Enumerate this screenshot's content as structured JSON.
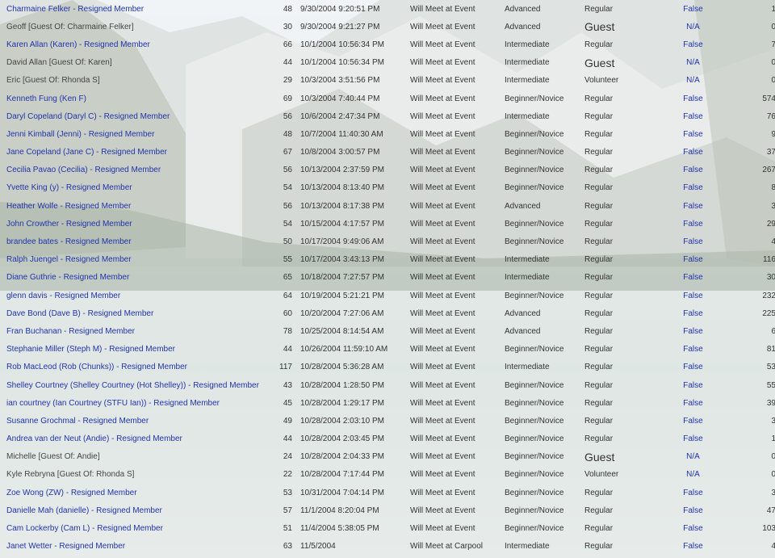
{
  "rows": [
    {
      "name": "Charmaine Felker - Resigned Member",
      "link": true,
      "age": "48",
      "date": "9/30/2004 9:20:51 PM",
      "meet": "Will Meet at Event",
      "level": "Advanced",
      "type": "Regular",
      "flag": "False",
      "num": "1"
    },
    {
      "name": "Geoff [Guest Of: Charmaine Felker]",
      "link": false,
      "age": "30",
      "date": "9/30/2004 9:21:27 PM",
      "meet": "Will Meet at Event",
      "level": "Advanced",
      "type": "Guest",
      "flag": "N/A",
      "num": "0"
    },
    {
      "name": "Karen Allan (Karen) - Resigned Member",
      "link": true,
      "age": "66",
      "date": "10/1/2004 10:56:34 PM",
      "meet": "Will Meet at Event",
      "level": "Intermediate",
      "type": "Regular",
      "flag": "False",
      "num": "7"
    },
    {
      "name": "David Allan [Guest Of: Karen]",
      "link": false,
      "age": "44",
      "date": "10/1/2004 10:56:34 PM",
      "meet": "Will Meet at Event",
      "level": "Intermediate",
      "type": "Guest",
      "flag": "N/A",
      "num": "0"
    },
    {
      "name": "Eric [Guest Of: Rhonda S]",
      "link": false,
      "age": "29",
      "date": "10/3/2004 3:51:56 PM",
      "meet": "Will Meet at Event",
      "level": "Intermediate",
      "type": "Volunteer",
      "flag": "N/A",
      "num": "0"
    },
    {
      "name": "Kenneth Fung (Ken F)",
      "link": true,
      "age": "69",
      "date": "10/3/2004 7:40:44 PM",
      "meet": "Will Meet at Event",
      "level": "Beginner/Novice",
      "type": "Regular",
      "flag": "False",
      "num": "574"
    },
    {
      "name": "Daryl Copeland (Daryl C) - Resigned Member",
      "link": true,
      "age": "56",
      "date": "10/6/2004 2:47:34 PM",
      "meet": "Will Meet at Event",
      "level": "Intermediate",
      "type": "Regular",
      "flag": "False",
      "num": "76"
    },
    {
      "name": "Jenni Kimball (Jenni) - Resigned Member",
      "link": true,
      "age": "48",
      "date": "10/7/2004 11:40:30 AM",
      "meet": "Will Meet at Event",
      "level": "Beginner/Novice",
      "type": "Regular",
      "flag": "False",
      "num": "9"
    },
    {
      "name": "Jane Copeland (Jane C) - Resigned Member",
      "link": true,
      "age": "67",
      "date": "10/8/2004 3:00:57 PM",
      "meet": "Will Meet at Event",
      "level": "Beginner/Novice",
      "type": "Regular",
      "flag": "False",
      "num": "37"
    },
    {
      "name": "Cecilia Pavao (Cecilia) - Resigned Member",
      "link": true,
      "age": "56",
      "date": "10/13/2004 2:37:59 PM",
      "meet": "Will Meet at Event",
      "level": "Beginner/Novice",
      "type": "Regular",
      "flag": "False",
      "num": "267"
    },
    {
      "name": "Yvette King (y) - Resigned Member",
      "link": true,
      "age": "54",
      "date": "10/13/2004 8:13:40 PM",
      "meet": "Will Meet at Event",
      "level": "Beginner/Novice",
      "type": "Regular",
      "flag": "False",
      "num": "8"
    },
    {
      "name": "Heather Wolfe - Resigned Member",
      "link": true,
      "age": "56",
      "date": "10/13/2004 8:17:38 PM",
      "meet": "Will Meet at Event",
      "level": "Advanced",
      "type": "Regular",
      "flag": "False",
      "num": "3"
    },
    {
      "name": "John Crowther - Resigned Member",
      "link": true,
      "age": "54",
      "date": "10/15/2004 4:17:57 PM",
      "meet": "Will Meet at Event",
      "level": "Beginner/Novice",
      "type": "Regular",
      "flag": "False",
      "num": "29"
    },
    {
      "name": "brandee bates - Resigned Member",
      "link": true,
      "age": "50",
      "date": "10/17/2004 9:49:06 AM",
      "meet": "Will Meet at Event",
      "level": "Beginner/Novice",
      "type": "Regular",
      "flag": "False",
      "num": "4"
    },
    {
      "name": "Ralph Juengel - Resigned Member",
      "link": true,
      "age": "55",
      "date": "10/17/2004 3:43:13 PM",
      "meet": "Will Meet at Event",
      "level": "Intermediate",
      "type": "Regular",
      "flag": "False",
      "num": "116"
    },
    {
      "name": "Diane Guthrie - Resigned Member",
      "link": true,
      "age": "65",
      "date": "10/18/2004 7:27:57 PM",
      "meet": "Will Meet at Event",
      "level": "Intermediate",
      "type": "Regular",
      "flag": "False",
      "num": "30"
    },
    {
      "name": "glenn davis - Resigned Member",
      "link": true,
      "age": "64",
      "date": "10/19/2004 5:21:21 PM",
      "meet": "Will Meet at Event",
      "level": "Beginner/Novice",
      "type": "Regular",
      "flag": "False",
      "num": "232"
    },
    {
      "name": "Dave Bond (Dave B) - Resigned Member",
      "link": true,
      "age": "60",
      "date": "10/20/2004 7:27:06 AM",
      "meet": "Will Meet at Event",
      "level": "Advanced",
      "type": "Regular",
      "flag": "False",
      "num": "225"
    },
    {
      "name": "Fran Buchanan - Resigned Member",
      "link": true,
      "age": "78",
      "date": "10/25/2004 8:14:54 AM",
      "meet": "Will Meet at Event",
      "level": "Advanced",
      "type": "Regular",
      "flag": "False",
      "num": "6"
    },
    {
      "name": "Stephanie Miller (Steph M) - Resigned Member",
      "link": true,
      "age": "44",
      "date": "10/26/2004 11:59:10 AM",
      "meet": "Will Meet at Event",
      "level": "Beginner/Novice",
      "type": "Regular",
      "flag": "False",
      "num": "81"
    },
    {
      "name": "Rob MacLeod (Rob (Chunks)) - Resigned Member",
      "link": true,
      "age": "117",
      "date": "10/28/2004 5:36:28 AM",
      "meet": "Will Meet at Event",
      "level": "Intermediate",
      "type": "Regular",
      "flag": "False",
      "num": "53"
    },
    {
      "name": "Shelley Courtney (Shelley Courtney (Hot Shelley)) - Resigned Member",
      "link": true,
      "age": "43",
      "date": "10/28/2004 1:28:50 PM",
      "meet": "Will Meet at Event",
      "level": "Beginner/Novice",
      "type": "Regular",
      "flag": "False",
      "num": "55"
    },
    {
      "name": "ian courtney (Ian Courtney (STFU Ian)) - Resigned Member",
      "link": true,
      "age": "45",
      "date": "10/28/2004 1:29:17 PM",
      "meet": "Will Meet at Event",
      "level": "Beginner/Novice",
      "type": "Regular",
      "flag": "False",
      "num": "39"
    },
    {
      "name": "Susanne Grochmal - Resigned Member",
      "link": true,
      "age": "49",
      "date": "10/28/2004 2:03:10 PM",
      "meet": "Will Meet at Event",
      "level": "Beginner/Novice",
      "type": "Regular",
      "flag": "False",
      "num": "3"
    },
    {
      "name": "Andrea van der Neut (Andie) - Resigned Member",
      "link": true,
      "age": "44",
      "date": "10/28/2004 2:03:45 PM",
      "meet": "Will Meet at Event",
      "level": "Beginner/Novice",
      "type": "Regular",
      "flag": "False",
      "num": "1"
    },
    {
      "name": "Michelle [Guest Of: Andie]",
      "link": false,
      "age": "24",
      "date": "10/28/2004 2:04:33 PM",
      "meet": "Will Meet at Event",
      "level": "Beginner/Novice",
      "type": "Guest",
      "flag": "N/A",
      "num": "0"
    },
    {
      "name": "Kyle Rebryna [Guest Of: Rhonda S]",
      "link": false,
      "age": "22",
      "date": "10/28/2004 7:17:44 PM",
      "meet": "Will Meet at Event",
      "level": "Beginner/Novice",
      "type": "Volunteer",
      "flag": "N/A",
      "num": "0"
    },
    {
      "name": "Zoe Wong (ZW) - Resigned Member",
      "link": true,
      "age": "53",
      "date": "10/31/2004 7:04:14 PM",
      "meet": "Will Meet at Event",
      "level": "Beginner/Novice",
      "type": "Regular",
      "flag": "False",
      "num": "3"
    },
    {
      "name": "Danielle Mah (danielle) - Resigned Member",
      "link": true,
      "age": "57",
      "date": "11/1/2004 8:20:04 PM",
      "meet": "Will Meet at Event",
      "level": "Beginner/Novice",
      "type": "Regular",
      "flag": "False",
      "num": "47"
    },
    {
      "name": "Cam Lockerby (Cam L) - Resigned Member",
      "link": true,
      "age": "51",
      "date": "11/4/2004 5:38:05 PM",
      "meet": "Will Meet at Event",
      "level": "Beginner/Novice",
      "type": "Regular",
      "flag": "False",
      "num": "103"
    },
    {
      "name": "Janet Wetter - Resigned Member",
      "link": true,
      "age": "63",
      "date": "11/5/2004",
      "meet": "Will Meet at Carpool",
      "level": "Intermediate",
      "type": "Regular",
      "flag": "False",
      "num": "4"
    }
  ],
  "colors": {
    "link": "#2233aa",
    "text": "#444444"
  }
}
